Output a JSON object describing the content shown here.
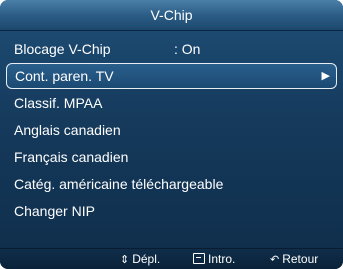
{
  "title": "V-Chip",
  "menu": {
    "items": [
      {
        "label": "Blocage V-Chip",
        "value": ": On"
      },
      {
        "label": "Cont. paren. TV",
        "arrow": "▶"
      },
      {
        "label": "Classif. MPAA"
      },
      {
        "label": "Anglais canadien"
      },
      {
        "label": "Français canadien"
      },
      {
        "label": "Catég. américaine téléchargeable"
      },
      {
        "label": "Changer NIP"
      }
    ],
    "selected_index": 1
  },
  "footer": {
    "move_icon": "up-down-arrows-icon",
    "move_label": "Dépl.",
    "enter_icon": "enter-icon",
    "enter_label": "Intro.",
    "return_icon": "return-icon",
    "return_label": "Retour"
  },
  "colors": {
    "panel": "#153a5c",
    "title_bar": "#2c5d86",
    "text": "#ffffff",
    "selection_border": "#e8eef4"
  }
}
